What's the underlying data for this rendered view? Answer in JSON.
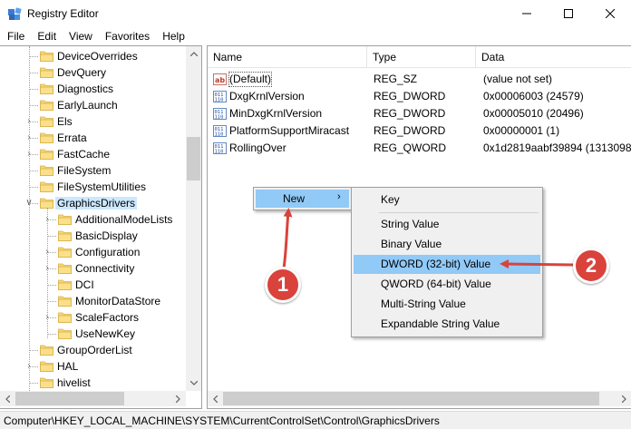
{
  "window": {
    "title": "Registry Editor",
    "icons": {
      "app": "registry-icon",
      "minimize": "minimize-icon",
      "maximize": "maximize-icon",
      "close": "close-icon"
    }
  },
  "menubar": {
    "items": [
      "File",
      "Edit",
      "View",
      "Favorites",
      "Help"
    ]
  },
  "tree": {
    "items": [
      {
        "label": "DeviceOverrides",
        "level": 0,
        "expander": ""
      },
      {
        "label": "DevQuery",
        "level": 0,
        "expander": ""
      },
      {
        "label": "Diagnostics",
        "level": 0,
        "expander": ""
      },
      {
        "label": "EarlyLaunch",
        "level": 0,
        "expander": ""
      },
      {
        "label": "Els",
        "level": 0,
        "expander": ">"
      },
      {
        "label": "Errata",
        "level": 0,
        "expander": ">"
      },
      {
        "label": "FastCache",
        "level": 0,
        "expander": ">"
      },
      {
        "label": "FileSystem",
        "level": 0,
        "expander": ""
      },
      {
        "label": "FileSystemUtilities",
        "level": 0,
        "expander": ""
      },
      {
        "label": "GraphicsDrivers",
        "level": 0,
        "expander": "v",
        "selected": true
      },
      {
        "label": "AdditionalModeLists",
        "level": 1,
        "expander": ">"
      },
      {
        "label": "BasicDisplay",
        "level": 1,
        "expander": ""
      },
      {
        "label": "Configuration",
        "level": 1,
        "expander": ">"
      },
      {
        "label": "Connectivity",
        "level": 1,
        "expander": ">"
      },
      {
        "label": "DCI",
        "level": 1,
        "expander": ""
      },
      {
        "label": "MonitorDataStore",
        "level": 1,
        "expander": ""
      },
      {
        "label": "ScaleFactors",
        "level": 1,
        "expander": ">"
      },
      {
        "label": "UseNewKey",
        "level": 1,
        "expander": ""
      },
      {
        "label": "GroupOrderList",
        "level": 0,
        "expander": ""
      },
      {
        "label": "HAL",
        "level": 0,
        "expander": ">"
      },
      {
        "label": "hivelist",
        "level": 0,
        "expander": ""
      }
    ]
  },
  "list": {
    "columns": [
      "Name",
      "Type",
      "Data"
    ],
    "rows": [
      {
        "icon": "string-value-icon",
        "name": "(Default)",
        "type": "REG_SZ",
        "data": "(value not set)"
      },
      {
        "icon": "binary-value-icon",
        "name": "DxgKrnlVersion",
        "type": "REG_DWORD",
        "data": "0x00006003 (24579)"
      },
      {
        "icon": "binary-value-icon",
        "name": "MinDxgKrnlVersion",
        "type": "REG_DWORD",
        "data": "0x00005010 (20496)"
      },
      {
        "icon": "binary-value-icon",
        "name": "PlatformSupportMiracast",
        "type": "REG_DWORD",
        "data": "0x00000001 (1)"
      },
      {
        "icon": "binary-value-icon",
        "name": "RollingOver",
        "type": "REG_QWORD",
        "data": "0x1d2819aabf39894 (1313098400"
      }
    ]
  },
  "context_menu": {
    "new_label": "New",
    "submenu": [
      "Key",
      "String Value",
      "Binary Value",
      "DWORD (32-bit) Value",
      "QWORD (64-bit) Value",
      "Multi-String Value",
      "Expandable String Value"
    ],
    "highlighted": "DWORD (32-bit) Value"
  },
  "annotations": {
    "badge_1": "1",
    "badge_2": "2",
    "color": "#d9433b"
  },
  "statusbar": {
    "path": "Computer\\HKEY_LOCAL_MACHINE\\SYSTEM\\CurrentControlSet\\Control\\GraphicsDrivers"
  }
}
